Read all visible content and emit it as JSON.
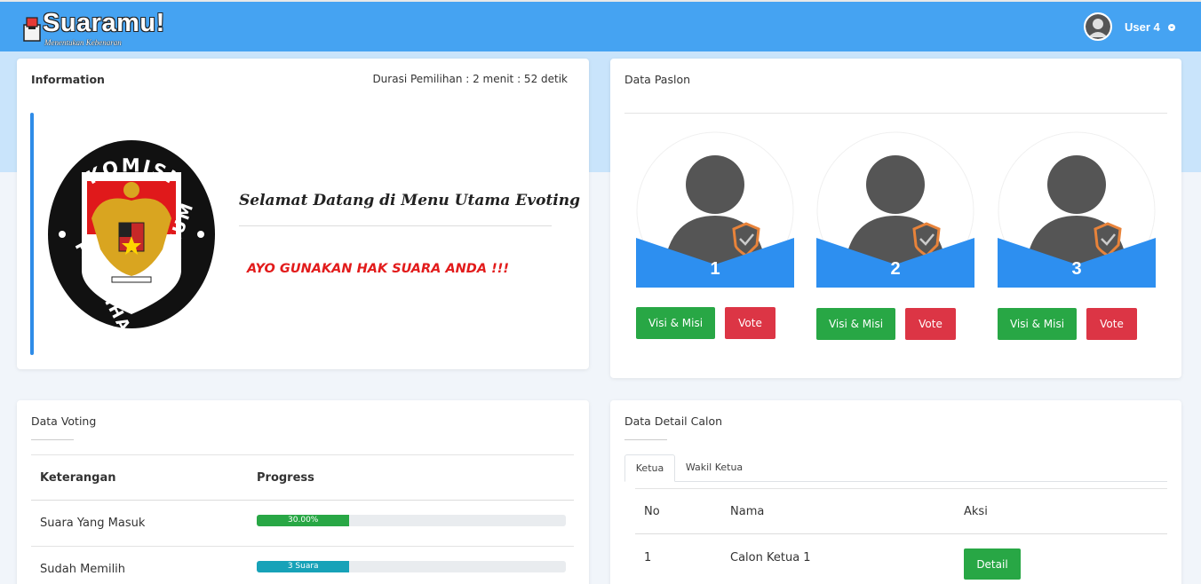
{
  "header": {
    "brand": "Suaramu!",
    "brand_tagline": "Menentukan Kebenaran",
    "user_name": "User 4"
  },
  "info": {
    "title": "Information",
    "durasi": "Durasi Pemilihan : 2 menit : 52 detik",
    "logo_text_top": "KOMISI",
    "logo_text_left": "PEMILIHAN",
    "logo_text_right": "UMUM",
    "welcome": "Selamat Datang di Menu Utama Evoting",
    "call_to_action": "AYO GUNAKAN HAK SUARA ANDA !!!"
  },
  "paslon": {
    "title": "Data Paslon",
    "candidates": [
      {
        "number": "1",
        "visi_label": "Visi & Misi",
        "vote_label": "Vote"
      },
      {
        "number": "2",
        "visi_label": "Visi & Misi",
        "vote_label": "Vote"
      },
      {
        "number": "3",
        "visi_label": "Visi & Misi",
        "vote_label": "Vote"
      }
    ]
  },
  "voting": {
    "title": "Data Voting",
    "headers": {
      "keterangan": "Keterangan",
      "progress": "Progress"
    },
    "rows": [
      {
        "label": "Suara Yang Masuk",
        "bar_text": "30.00%",
        "fraction": 0.3,
        "color": "#28a745"
      },
      {
        "label": "Sudah Memilih",
        "bar_text": "3 Suara",
        "fraction": 0.3,
        "color": "#17a2b8"
      }
    ]
  },
  "detail": {
    "title": "Data Detail Calon",
    "tabs": [
      "Ketua",
      "Wakil Ketua"
    ],
    "active_tab": "Ketua",
    "headers": {
      "no": "No",
      "nama": "Nama",
      "aksi": "Aksi"
    },
    "rows": [
      {
        "no": "1",
        "nama": "Calon Ketua 1",
        "action_label": "Detail"
      }
    ]
  },
  "colors": {
    "topbar": "#45a3f2",
    "accent_blue": "#2f8ce8",
    "green": "#28a745",
    "red": "#dc3545",
    "teal": "#17a2b8"
  }
}
